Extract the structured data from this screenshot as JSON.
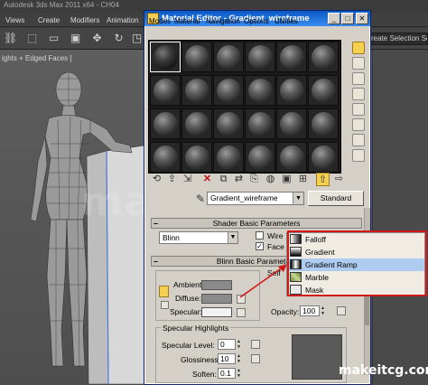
{
  "max": {
    "title_fragment": "Autodesk 3ds Max 2011 x64 - CH04",
    "menus": [
      "Views",
      "Create",
      "Modifiers",
      "Animation"
    ],
    "viewport_label": "ights + Edged Faces ]",
    "selection_set_placeholder": "reate Selection Se"
  },
  "med": {
    "title": "Material Editor - Gradient_wireframe",
    "menus": [
      "Modes",
      "Material",
      "Navigation",
      "Options",
      "Utilities"
    ],
    "material_name": "Gradient_wireframe",
    "material_type_button": "Standard",
    "rollouts": {
      "shader_basic": "Shader Basic Parameters",
      "blinn_basic": "Blinn Basic Parameters"
    },
    "shader": "Blinn",
    "checkboxes": {
      "wire": "Wire",
      "face_map": "Face M"
    },
    "color_labels": {
      "ambient": "Ambient:",
      "diffuse": "Diffuse:",
      "specular": "Specular:"
    },
    "self_illum_label": "Self",
    "opacity": {
      "label": "Opacity:",
      "value": "100"
    },
    "specular_highlights": {
      "title": "Specular Highlights",
      "specular_level": {
        "label": "Specular Level:",
        "value": "0"
      },
      "glossiness": {
        "label": "Glossiness:",
        "value": "10"
      },
      "soften": {
        "label": "Soften:",
        "value": "0.1"
      }
    }
  },
  "popup_menu": {
    "items": [
      {
        "label": "Falloff",
        "icon": "falloff-icon"
      },
      {
        "label": "Gradient",
        "icon": "gradient-icon"
      },
      {
        "label": "Gradient Ramp",
        "icon": "gradient-ramp-icon"
      },
      {
        "label": "Marble",
        "icon": "marble-icon"
      },
      {
        "label": "Mask",
        "icon": "mask-icon"
      }
    ],
    "highlighted_item": "Gradient Ramp"
  },
  "watermark": "makeitcg",
  "site_label": "makeitcg.com",
  "colors": {
    "title_bar": "#0a58c6",
    "highlight": "#aecbf0",
    "annotation_red": "#d01818",
    "active_tool": "#f4d050"
  }
}
